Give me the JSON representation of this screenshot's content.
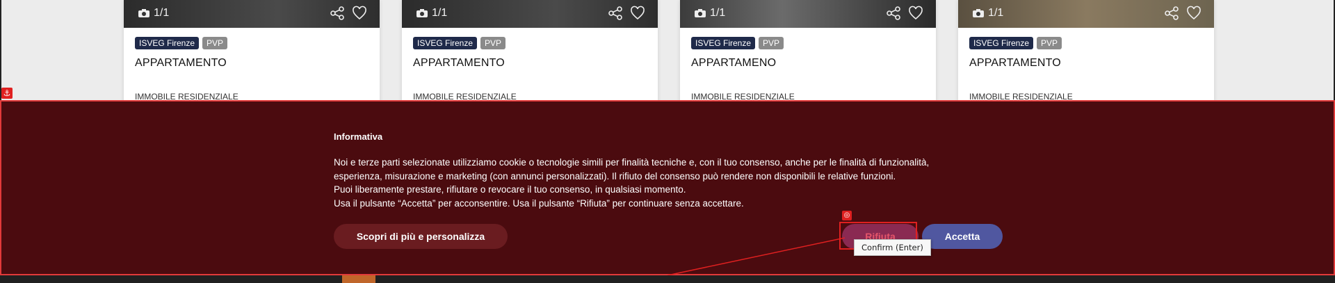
{
  "listings": [
    {
      "photo_count": "1/1",
      "agency": "ISVEG Firenze",
      "channel": "PVP",
      "title": "APPARTAMENTO",
      "category": "IMMOBILE RESIDENZIALE"
    },
    {
      "photo_count": "1/1",
      "agency": "ISVEG Firenze",
      "channel": "PVP",
      "title": "APPARTAMENTO",
      "category": "IMMOBILE RESIDENZIALE"
    },
    {
      "photo_count": "1/1",
      "agency": "ISVEG Firenze",
      "channel": "PVP",
      "title": "APPARTAMENO",
      "category": "IMMOBILE RESIDENZIALE"
    },
    {
      "photo_count": "1/1",
      "agency": "ISVEG Firenze",
      "channel": "PVP",
      "title": "APPARTAMENTO",
      "category": "IMMOBILE RESIDENZIALE"
    }
  ],
  "cookie_banner": {
    "title": "Informativa",
    "paragraphs": [
      "Noi e terze parti selezionate utilizziamo cookie o tecnologie simili per finalità tecniche e, con il tuo consenso, anche per le finalità di funzionalità, esperienza, misurazione e marketing (con annunci personalizzati). Il rifiuto del consenso può rendere non disponibili le relative funzioni.",
      "Puoi liberamente prestare, rifiutare o revocare il tuo consenso, in qualsiasi momento.",
      "Usa il pulsante “Accetta” per acconsentire. Usa il pulsante “Rifiuta” per continuare senza accettare."
    ],
    "learn_more_label": "Scopri di più e personalizza",
    "reject_label": "Rifiuta",
    "accept_label": "Accetta"
  },
  "overlay": {
    "tooltip": "Confirm (Enter)"
  },
  "icons": {
    "photo": "camera-icon",
    "share": "share-icon",
    "favorite": "heart-icon",
    "anchor": "anchor-icon",
    "target": "target-icon"
  },
  "colors": {
    "banner_background": "#4b0b0f",
    "accept_button": "#5057a0",
    "reject_button": "#8a2a52",
    "learn_more_button": "#6a1c20",
    "agency_badge": "#1f2a4a",
    "highlight": "#e02020"
  }
}
